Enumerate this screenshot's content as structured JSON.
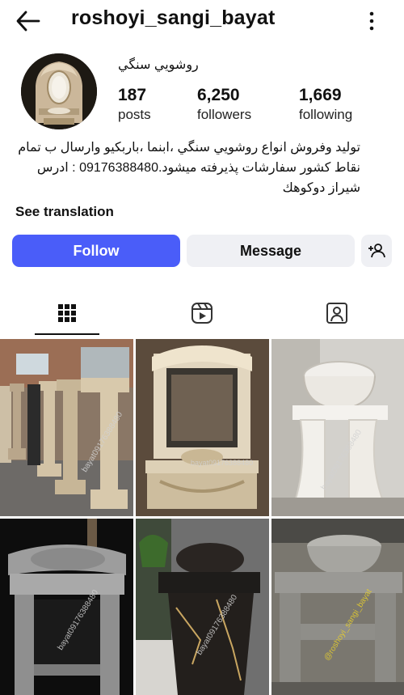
{
  "header": {
    "username": "roshoyi_sangi_bayat",
    "back_icon": "arrow-left-icon",
    "more_icon": "more-vertical-icon"
  },
  "profile": {
    "display_name": "روشويي سنگي",
    "stats": [
      {
        "value": "187",
        "label": "posts"
      },
      {
        "value": "6,250",
        "label": "followers"
      },
      {
        "value": "1,669",
        "label": "following"
      }
    ],
    "bio_lines": [
      "توليد وفروش انواع روشويي سنگي ،ابنما ،باربكيو وارسال ب تمام",
      "نقاط کشور سفارشات پذيرفته ميشود.09176388480 : ادرس",
      "شيراز دوكوهك"
    ],
    "see_translation": "See translation"
  },
  "actions": {
    "follow": "Follow",
    "message": "Message",
    "add_user_icon": "person-add-icon"
  },
  "tabs": [
    {
      "name": "grid",
      "icon": "grid-icon",
      "active": true
    },
    {
      "name": "reels",
      "icon": "reels-icon",
      "active": false
    },
    {
      "name": "tagged",
      "icon": "tagged-user-icon",
      "active": false
    }
  ],
  "posts": {
    "watermarks": [
      "bayat09176388480",
      "bayat09176388480",
      "bayat09176388480",
      "bayat09176388480",
      "bayat09176388480",
      "@roshoyi_sangi_bayat"
    ]
  },
  "colors": {
    "follow_bg": "#4a5df9",
    "secondary_bg": "#eff0f4",
    "text": "#111111"
  }
}
